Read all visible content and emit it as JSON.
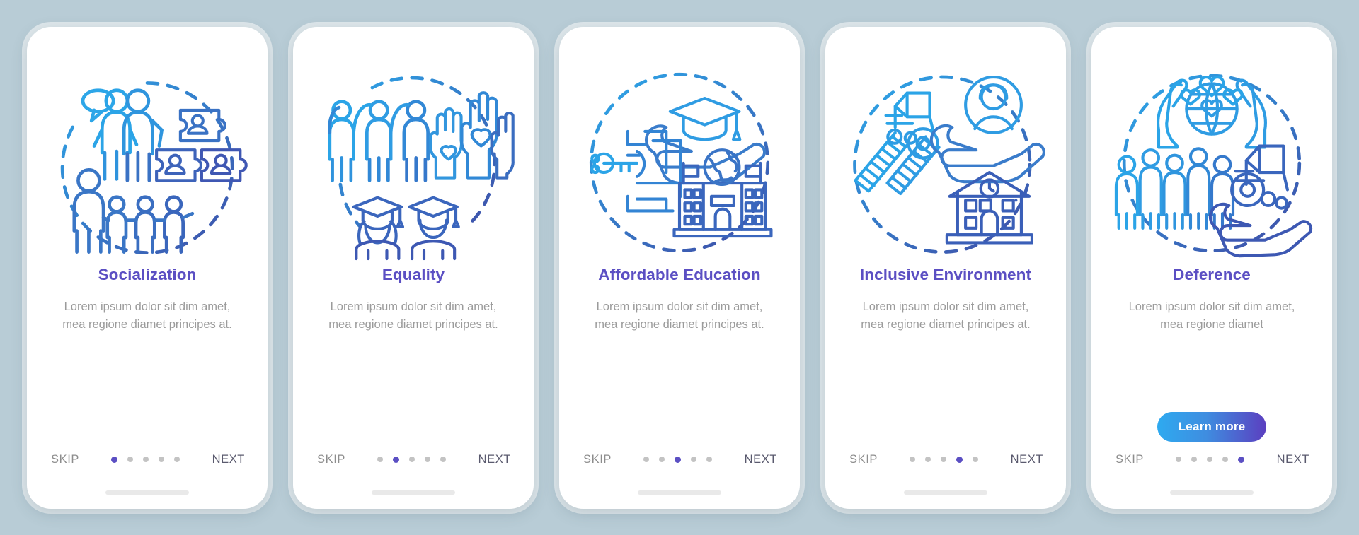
{
  "background_color": "#b8ccd6",
  "accent_title_color": "#5b4fc3",
  "body_text_color": "#9b9b9b",
  "dot_active_color": "#5b4fc3",
  "dot_inactive_color": "#c3c3c3",
  "cta_gradient": [
    "#2eaaf0",
    "#5b3fc0"
  ],
  "common": {
    "skip_label": "SKIP",
    "next_label": "NEXT",
    "description": "Lorem ipsum dolor sit dim amet, mea regione diamet principes at.",
    "description_short": "Lorem ipsum dolor sit dim amet, mea regione diamet",
    "total_steps": 5
  },
  "screens": [
    {
      "title": "Socialization",
      "description": "Lorem ipsum dolor sit dim amet, mea regione diamet principes at.",
      "active_step": 1,
      "skip_label": "SKIP",
      "next_label": "NEXT",
      "cta_label": null,
      "illustration": "socialization-illustration"
    },
    {
      "title": "Equality",
      "description": "Lorem ipsum dolor sit dim amet, mea regione diamet principes at.",
      "active_step": 2,
      "skip_label": "SKIP",
      "next_label": "NEXT",
      "cta_label": null,
      "illustration": "equality-illustration"
    },
    {
      "title": "Affordable Education",
      "description": "Lorem ipsum dolor sit dim amet, mea regione diamet principes at.",
      "active_step": 3,
      "skip_label": "SKIP",
      "next_label": "NEXT",
      "cta_label": null,
      "illustration": "affordable-education-illustration"
    },
    {
      "title": "Inclusive Environment",
      "description": "Lorem ipsum dolor sit dim amet, mea regione diamet principes at.",
      "active_step": 4,
      "skip_label": "SKIP",
      "next_label": "NEXT",
      "cta_label": null,
      "illustration": "inclusive-environment-illustration"
    },
    {
      "title": "Deference",
      "description": "Lorem ipsum dolor sit dim amet, mea regione diamet",
      "active_step": 5,
      "skip_label": "SKIP",
      "next_label": "NEXT",
      "cta_label": "Learn more",
      "illustration": "deference-illustration"
    }
  ]
}
